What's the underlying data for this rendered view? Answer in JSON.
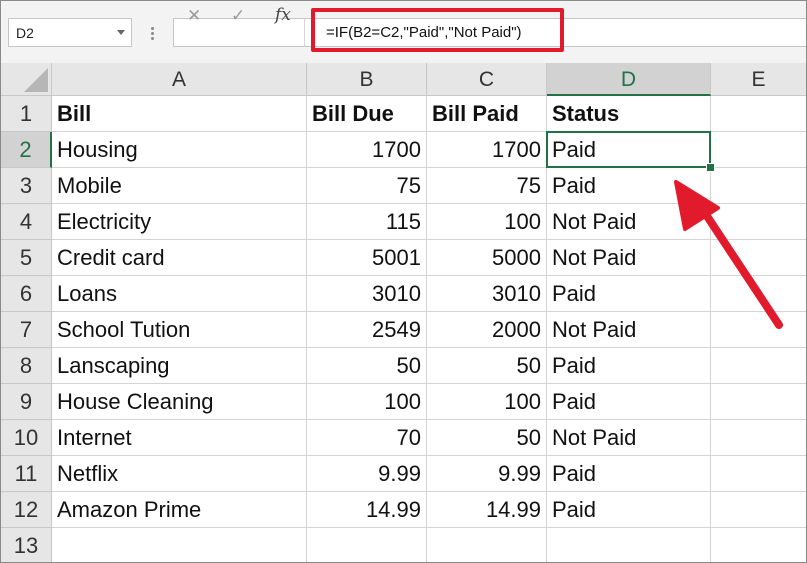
{
  "name_box": {
    "value": "D2"
  },
  "formula_bar": {
    "cancel_icon": "✕",
    "enter_icon": "✓",
    "fx_label": "fx",
    "formula": "=IF(B2=C2,\"Paid\",\"Not Paid\")",
    "highlight_color": "#e21b2c"
  },
  "columns": [
    "A",
    "B",
    "C",
    "D",
    "E"
  ],
  "row_numbers": [
    "1",
    "2",
    "3",
    "4",
    "5",
    "6",
    "7",
    "8",
    "9",
    "10",
    "11",
    "12",
    "13"
  ],
  "selected_cell": "D2",
  "accent_color": "#217346",
  "rows": [
    {
      "a": "Bill",
      "b": "Bill Due",
      "c": "Bill Paid",
      "d": "Status"
    },
    {
      "a": "Housing",
      "b": "1700",
      "c": "1700",
      "d": "Paid"
    },
    {
      "a": "Mobile",
      "b": "75",
      "c": "75",
      "d": "Paid"
    },
    {
      "a": "Electricity",
      "b": "115",
      "c": "100",
      "d": "Not Paid"
    },
    {
      "a": "Credit card",
      "b": "5001",
      "c": "5000",
      "d": "Not Paid"
    },
    {
      "a": "Loans",
      "b": "3010",
      "c": "3010",
      "d": "Paid"
    },
    {
      "a": "School Tution",
      "b": "2549",
      "c": "2000",
      "d": "Not Paid"
    },
    {
      "a": "Lanscaping",
      "b": "50",
      "c": "50",
      "d": "Paid"
    },
    {
      "a": "House Cleaning",
      "b": "100",
      "c": "100",
      "d": "Paid"
    },
    {
      "a": "Internet",
      "b": "70",
      "c": "50",
      "d": "Not Paid"
    },
    {
      "a": "Netflix",
      "b": "9.99",
      "c": "9.99",
      "d": "Paid"
    },
    {
      "a": "Amazon Prime",
      "b": "14.99",
      "c": "14.99",
      "d": "Paid"
    },
    {
      "a": "",
      "b": "",
      "c": "",
      "d": ""
    }
  ]
}
